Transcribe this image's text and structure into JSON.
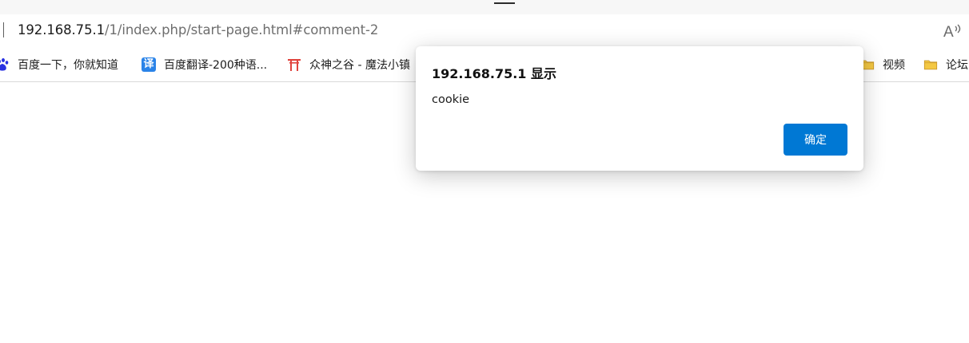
{
  "address_bar": {
    "url_host": "192.168.75.1",
    "url_path": "/1/index.php/start-page.html#comment-2",
    "read_aloud_icon": "read-aloud-icon"
  },
  "bookmarks": [
    {
      "label": "百度一下，你就知道",
      "icon": "baidu-paw-icon"
    },
    {
      "label": "百度翻译-200种语...",
      "icon": "fanyi-icon",
      "icon_text": "译"
    },
    {
      "label": "众神之谷 - 魔法小镇",
      "icon": "torii-gate-icon"
    },
    {
      "label": "视频",
      "icon": "folder-icon"
    },
    {
      "label": "论坛",
      "icon": "folder-icon"
    }
  ],
  "dialog": {
    "title": "192.168.75.1 显示",
    "message": "cookie",
    "ok_label": "确定"
  },
  "colors": {
    "accent": "#0078d4",
    "fanyi_blue": "#2a83e8",
    "baidu_blue": "#2932e1",
    "torii_red": "#e0443e",
    "folder_yellow": "#f4c843"
  }
}
